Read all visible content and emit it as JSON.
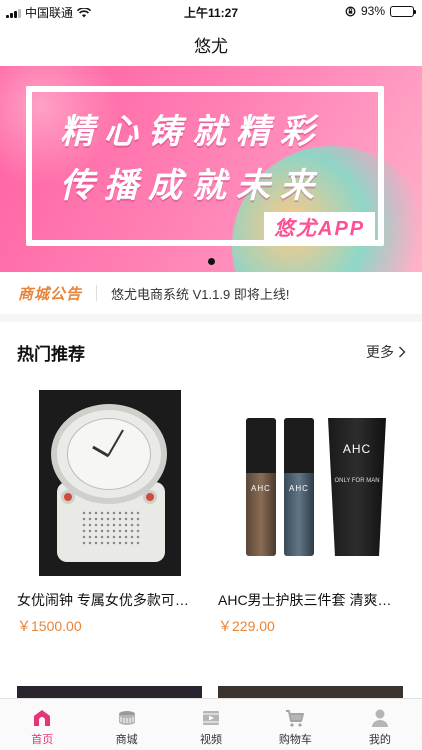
{
  "status_bar": {
    "carrier": "中国联通",
    "time": "上午11:27",
    "battery_pct": "93%",
    "battery_level": 0.93
  },
  "nav": {
    "title": "悠尤"
  },
  "banner": {
    "line1": "精心铸就精彩",
    "line2": "传播成就未来",
    "app_tag": "悠尤APP",
    "page_count": 1,
    "active_page": 0
  },
  "notice": {
    "tag": "商城公告",
    "message": "悠尤电商系统 V1.1.9 即将上线!"
  },
  "section": {
    "title": "热门推荐",
    "more_label": "更多"
  },
  "products": [
    {
      "name": "女优闹钟 专属女优多款可选 早上叫你起床",
      "price": "￥1500.00"
    },
    {
      "name": "AHC男士护肤三件套 清爽控油",
      "price": "￥229.00"
    }
  ],
  "tab_bar": {
    "items": [
      {
        "label": "首页",
        "icon": "home-icon",
        "active": true
      },
      {
        "label": "商城",
        "icon": "mall-icon",
        "active": false
      },
      {
        "label": "视频",
        "icon": "video-icon",
        "active": false
      },
      {
        "label": "购物车",
        "icon": "cart-icon",
        "active": false
      },
      {
        "label": "我的",
        "icon": "profile-icon",
        "active": false
      }
    ]
  },
  "colors": {
    "accent": "#e2357a",
    "price": "#e8843a",
    "banner_pink": "#ff6fa8"
  }
}
